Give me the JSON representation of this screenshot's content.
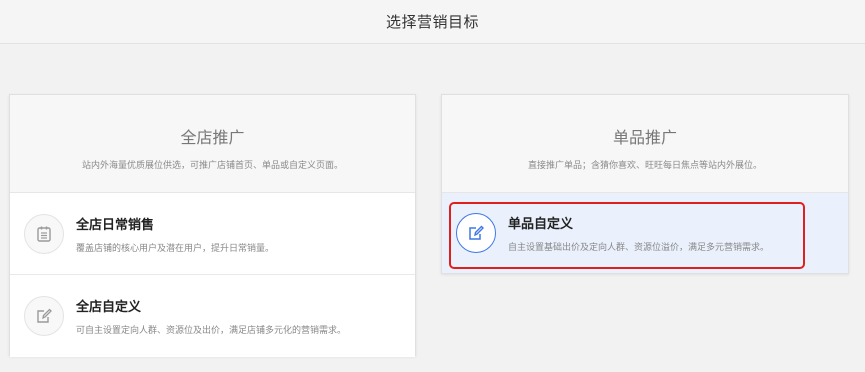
{
  "header": {
    "title": "选择营销目标"
  },
  "cards": {
    "store": {
      "title": "全店推广",
      "subtitle": "站内外海量优质展位供选，可推广店铺首页、单品或自定义页面。",
      "options": [
        {
          "title": "全店日常销售",
          "desc": "覆盖店铺的核心用户及潜在用户，提升日常销量。",
          "icon": "calendar-list-icon"
        },
        {
          "title": "全店自定义",
          "desc": "可自主设置定向人群、资源位及出价，满足店铺多元化的营销需求。",
          "icon": "edit-icon"
        }
      ]
    },
    "single": {
      "title": "单品推广",
      "subtitle": "直接推广单品；含猜你喜欢、旺旺每日焦点等站内外展位。",
      "options": [
        {
          "title": "单品自定义",
          "desc": "自主设置基础出价及定向人群、资源位溢价，满足多元营销需求。",
          "icon": "edit-icon",
          "selected": true
        }
      ]
    }
  },
  "colors": {
    "accent": "#3f78e6",
    "highlight": "#e0201c",
    "selected_bg": "#eaf1fd"
  }
}
